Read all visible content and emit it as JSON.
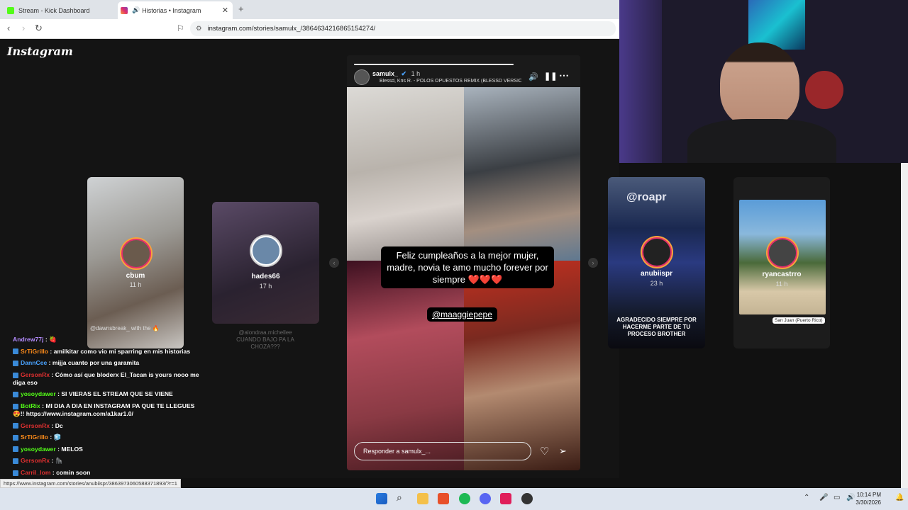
{
  "browser": {
    "tabs": [
      {
        "title": "Stream - Kick Dashboard",
        "favicon_color": "#53fc18"
      },
      {
        "title": "Historias • Instagram",
        "favicon_color": "#e1306c"
      }
    ],
    "url": "instagram.com/stories/samulx_/3864634216865154274/",
    "status_url": "https://www.instagram.com/stories/anubiispr/3863973060588371893/?r=1"
  },
  "instagram": {
    "logo": "Instagram",
    "side_stories": [
      {
        "user": "cbum",
        "time": "11 h",
        "overlay": "@dawnsbreak_ with the 🔥"
      },
      {
        "user": "hades66",
        "time": "17 h",
        "overlay": "@alondraa.michellee CUANDO BAJO PA LA CHOZA???"
      },
      {
        "user": "anubiispr",
        "time": "23 h",
        "top_text": "@roapr",
        "bottom_text": "AGRADECIDO SIEMPRE POR HACERME PARTE DE TU PROCESO BROTHER"
      },
      {
        "user": "ryancastrro",
        "time": "11 h",
        "location": "San Juan (Puerto Rico)"
      }
    ],
    "story": {
      "user": "samulx_",
      "time": "1 h",
      "music": "Blessd, Kris R. - POLOS OPUESTOS REMIX (BLESSD VERSION)",
      "caption": "Feliz cumpleaños a la mejor mujer, madre, novia te amo mucho forever por siempre ❤️❤️❤️",
      "mention": "@maaggiepepe",
      "reply_placeholder": "Responder a samulx_..."
    }
  },
  "chat": [
    {
      "user": "Andrew77j",
      "color": "#b48cff",
      "msg": "🍓"
    },
    {
      "user": "SrTiGrillo",
      "color": "#ff8c1a",
      "msg": "amilkitar como vio mi sparring en mis historias"
    },
    {
      "user": "DannCee",
      "color": "#4aa3ff",
      "msg": "mijja cuanto por una garamita"
    },
    {
      "user": "GersonRx",
      "color": "#e03030",
      "msg": "Cómo así que bloderx El_Tacan is yours nooo me diga eso"
    },
    {
      "user": "yosoydawer",
      "color": "#53fc18",
      "msg": "SI VIERAS EL STREAM QUE SE VIENE"
    },
    {
      "user": "BotRix",
      "color": "#53fc18",
      "msg": "MI DIA A DIA EN INSTAGRAM PA QUE TE LLEGUES 😍!! https://www.instagram.com/a1kar1.0/"
    },
    {
      "user": "GersonRx",
      "color": "#e03030",
      "msg": "Dc"
    },
    {
      "user": "SrTiGrillo",
      "color": "#ff8c1a",
      "msg": "🧊"
    },
    {
      "user": "yosoydawer",
      "color": "#53fc18",
      "msg": "MELOS"
    },
    {
      "user": "GersonRx",
      "color": "#e03030",
      "msg": "🦍"
    },
    {
      "user": "Carril_lom",
      "color": "#e03030",
      "msg": "comin soon"
    }
  ],
  "taskbar": {
    "time": "10:14 PM",
    "date": "3/30/2026"
  }
}
